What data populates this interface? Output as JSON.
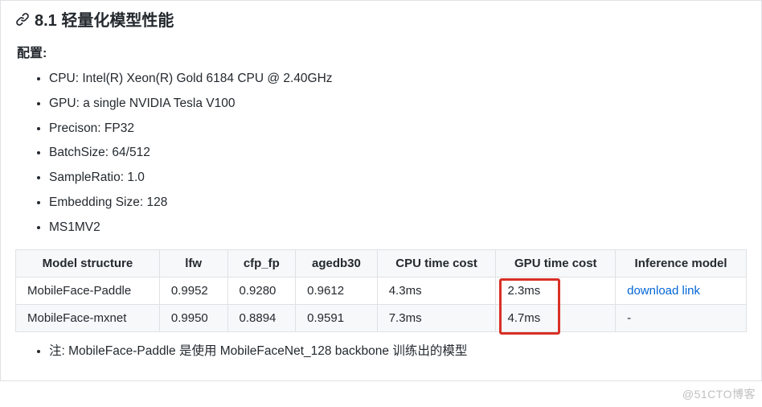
{
  "heading": "8.1 轻量化模型性能",
  "config_label": "配置:",
  "config_items": [
    "CPU: Intel(R) Xeon(R) Gold 6184 CPU @ 2.40GHz",
    "GPU: a single NVIDIA Tesla V100",
    "Precison: FP32",
    "BatchSize: 64/512",
    "SampleRatio: 1.0",
    "Embedding Size: 128",
    "MS1MV2"
  ],
  "table": {
    "headers": [
      "Model structure",
      "lfw",
      "cfp_fp",
      "agedb30",
      "CPU time cost",
      "GPU time cost",
      "Inference model"
    ],
    "rows": [
      {
        "model": "MobileFace-Paddle",
        "lfw": "0.9952",
        "cfp_fp": "0.9280",
        "agedb30": "0.9612",
        "cpu": "4.3ms",
        "gpu": "2.3ms",
        "inference": "download link",
        "inference_is_link": true
      },
      {
        "model": "MobileFace-mxnet",
        "lfw": "0.9950",
        "cfp_fp": "0.8894",
        "agedb30": "0.9591",
        "cpu": "7.3ms",
        "gpu": "4.7ms",
        "inference": "-",
        "inference_is_link": false
      }
    ]
  },
  "chart_data": {
    "type": "table",
    "title": "8.1 轻量化模型性能",
    "columns": [
      "Model structure",
      "lfw",
      "cfp_fp",
      "agedb30",
      "CPU time cost (ms)",
      "GPU time cost (ms)",
      "Inference model"
    ],
    "rows": [
      [
        "MobileFace-Paddle",
        0.9952,
        0.928,
        0.9612,
        4.3,
        2.3,
        "download link"
      ],
      [
        "MobileFace-mxnet",
        0.995,
        0.8894,
        0.9591,
        7.3,
        4.7,
        "-"
      ]
    ],
    "highlight": {
      "column": "GPU time cost (ms)",
      "rows": [
        0,
        1
      ]
    }
  },
  "note": "注: MobileFace-Paddle 是使用 MobileFaceNet_128 backbone 训练出的模型",
  "watermark": "@51CTO博客"
}
